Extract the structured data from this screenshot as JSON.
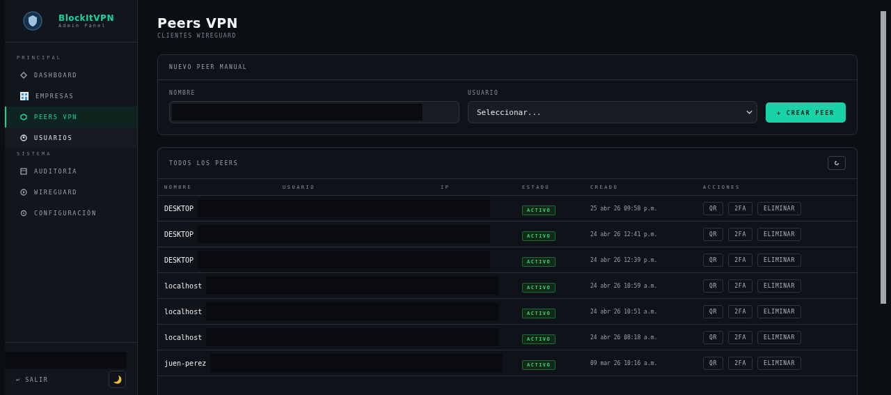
{
  "brand": {
    "name": "BlockItVPN",
    "subtitle": "Admin Panel"
  },
  "sidebar": {
    "sections": [
      {
        "title": "PRINCIPAL",
        "items": [
          {
            "label": "DASHBOARD",
            "selected": false,
            "hovered": false
          },
          {
            "label": "EMPRESAS",
            "selected": false,
            "hovered": false
          },
          {
            "label": "PEERS VPN",
            "selected": true,
            "hovered": false
          },
          {
            "label": "USUARIOS",
            "selected": false,
            "hovered": true
          }
        ]
      },
      {
        "title": "SISTEMA",
        "items": [
          {
            "label": "AUDITORÍA",
            "selected": false,
            "hovered": false
          },
          {
            "label": "WIREGUARD",
            "selected": false,
            "hovered": false
          },
          {
            "label": "CONFIGURACIÓN",
            "selected": false,
            "hovered": false
          }
        ]
      }
    ],
    "logout": "SALIR",
    "logout_icon": "↩"
  },
  "page": {
    "title": "Peers VPN",
    "subtitle": "CLIENTES WIREGUARD"
  },
  "form": {
    "title": "NUEVO PEER MANUAL",
    "name_label": "NOMBRE",
    "user_label": "USUARIO",
    "user_value": "Seleccionar...",
    "button": "+ CREAR PEER"
  },
  "table": {
    "title": "TODOS LOS PEERS",
    "columns": [
      "NOMBRE",
      "USUARIO",
      "IP",
      "ESTADO",
      "CREADO",
      "ACCIONES"
    ],
    "rows": [
      {
        "name": "DESKTOP",
        "status": "ACTIVO",
        "created": "25 abr 26 09:58 p.m.",
        "actions": [
          "QR",
          "2FA",
          "ELIMINAR"
        ]
      },
      {
        "name": "DESKTOP",
        "status": "ACTIVO",
        "created": "24 abr 26 12:41 p.m.",
        "actions": [
          "QR",
          "2FA",
          "ELIMINAR"
        ]
      },
      {
        "name": "DESKTOP",
        "status": "ACTIVO",
        "created": "24 abr 26 12:39 p.m.",
        "actions": [
          "QR",
          "2FA",
          "ELIMINAR"
        ]
      },
      {
        "name": "localhost",
        "status": "ACTIVO",
        "created": "24 abr 26 10:59 a.m.",
        "actions": [
          "QR",
          "2FA",
          "ELIMINAR"
        ]
      },
      {
        "name": "localhost",
        "status": "ACTIVO",
        "created": "24 abr 26 10:51 a.m.",
        "actions": [
          "QR",
          "2FA",
          "ELIMINAR"
        ]
      },
      {
        "name": "localhost",
        "status": "ACTIVO",
        "created": "24 abr 26 08:18 a.m.",
        "actions": [
          "QR",
          "2FA",
          "ELIMINAR"
        ]
      },
      {
        "name": "juen-perez",
        "status": "ACTIVO",
        "created": "09 mar 26 10:16 a.m.",
        "actions": [
          "QR",
          "2FA",
          "ELIMINAR"
        ]
      }
    ]
  }
}
